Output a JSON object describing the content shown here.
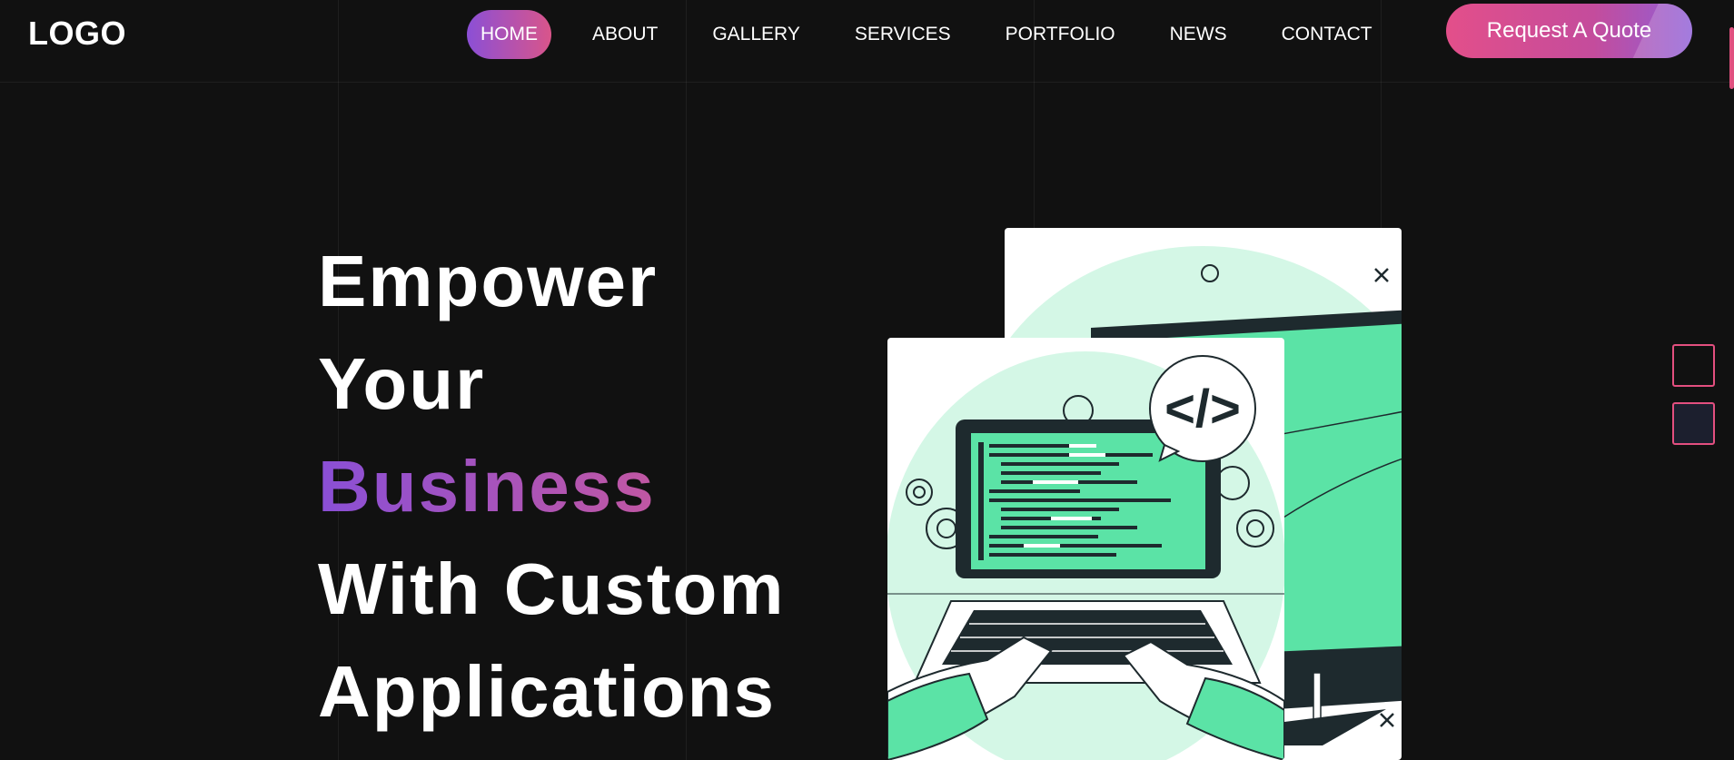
{
  "header": {
    "logo": "LOGO",
    "nav": [
      {
        "label": "HOME",
        "active": true
      },
      {
        "label": "ABOUT",
        "active": false
      },
      {
        "label": "GALLERY",
        "active": false
      },
      {
        "label": "SERVICES",
        "active": false
      },
      {
        "label": "PORTFOLIO",
        "active": false
      },
      {
        "label": "NEWS",
        "active": false
      },
      {
        "label": "CONTACT",
        "active": false
      }
    ],
    "quote_button": "Request A Quote"
  },
  "hero": {
    "line1": "Empower",
    "line2": "Your",
    "line3": "Business",
    "line4": "With Custom",
    "line5": "Applications"
  },
  "illustration": {
    "code_bubble": "</>"
  },
  "colors": {
    "background": "#111111",
    "accent_pink": "#e34f8a",
    "accent_purple": "#8b4fd6",
    "mint": "#5be3a6",
    "mint_light": "#d4f7e6",
    "dark_navy": "#1e2a2e"
  }
}
